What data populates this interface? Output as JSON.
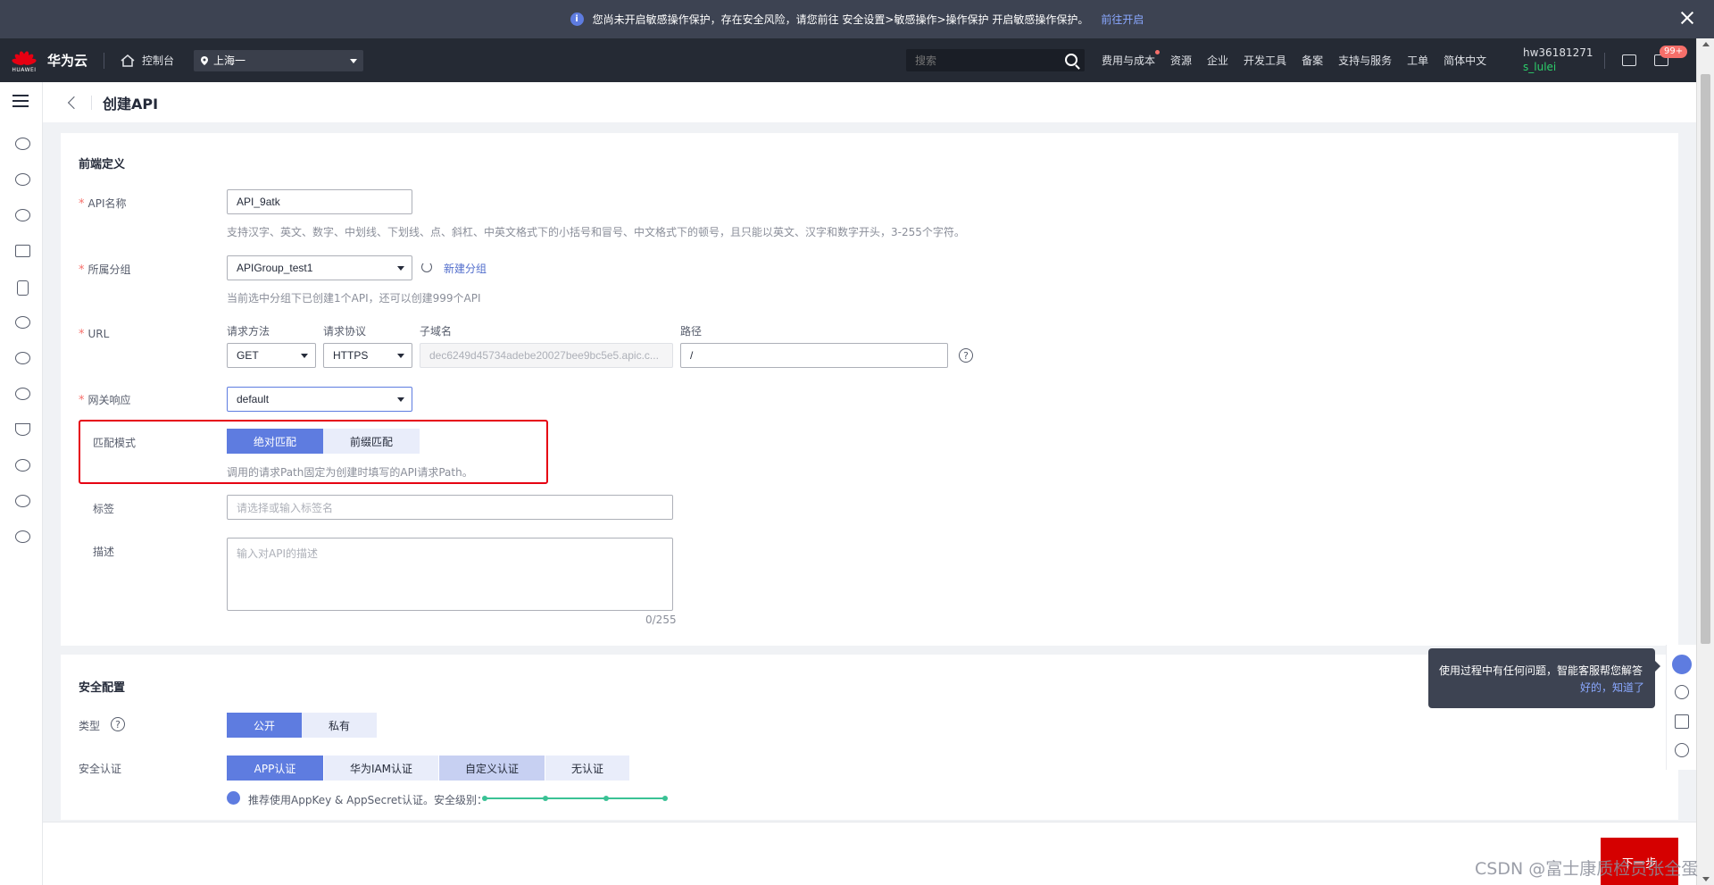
{
  "notice": {
    "text": "您尚未开启敏感操作保护，存在安全风险，请您前往 安全设置>敏感操作>操作保护 开启敏感操作保护。",
    "link": "前往开启",
    "info_glyph": "i"
  },
  "topnav": {
    "logo_sub": "HUAWEI",
    "brand": "华为云",
    "console": "控制台",
    "region": "上海一",
    "search_placeholder": "搜索",
    "links": [
      "费用与成本",
      "资源",
      "企业",
      "开发工具",
      "备案",
      "支持与服务",
      "工单",
      "简体中文"
    ],
    "user_name": "hw36181271",
    "user_sub": "s_lulei",
    "mail_badge": "99+"
  },
  "page": {
    "title": "创建API"
  },
  "frontend": {
    "section_title": "前端定义",
    "api_name": {
      "label": "API名称",
      "value": "API_9atk",
      "hint": "支持汉字、英文、数字、中划线、下划线、点、斜杠、中英文格式下的小括号和冒号、中文格式下的顿号，且只能以英文、汉字和数字开头，3-255个字符。"
    },
    "group": {
      "label": "所属分组",
      "value": "APIGroup_test1",
      "new_link": "新建分组",
      "hint": "当前选中分组下已创建1个API，还可以创建999个API"
    },
    "url": {
      "label": "URL",
      "method_label": "请求方法",
      "method_value": "GET",
      "protocol_label": "请求协议",
      "protocol_value": "HTTPS",
      "subdomain_label": "子域名",
      "subdomain_value": "dec6249d45734adebe20027bee9bc5e5.apic.c...",
      "path_label": "路径",
      "path_value": "/",
      "help_glyph": "?"
    },
    "gateway_response": {
      "label": "网关响应",
      "value": "default"
    },
    "match_mode": {
      "label": "匹配模式",
      "options": [
        "绝对匹配",
        "前缀匹配"
      ],
      "hint": "调用的请求Path固定为创建时填写的API请求Path。"
    },
    "tags": {
      "label": "标签",
      "placeholder": "请选择或输入标签名"
    },
    "description": {
      "label": "描述",
      "placeholder": "输入对API的描述",
      "counter": "0/255"
    }
  },
  "security": {
    "section_title": "安全配置",
    "type": {
      "label": "类型",
      "options": [
        "公开",
        "私有"
      ],
      "help_glyph": "?"
    },
    "auth": {
      "label": "安全认证",
      "options": [
        "APP认证",
        "华为IAM认证",
        "自定义认证",
        "无认证"
      ],
      "hint": "推荐使用AppKey & AppSecret认证。安全级别："
    }
  },
  "footer": {
    "next": "下一步",
    "watermark": "CSDN @富士康质检员张全蛋"
  },
  "assistant": {
    "tip": "使用过程中有任何问题，智能客服帮您解答",
    "ok": "好的，知道了"
  },
  "colors": {
    "primary": "#5e7ce0",
    "required": "#f66f6a",
    "highlight_box": "#e60012",
    "next_button": "#d50000",
    "level_bar": "#3ac295"
  }
}
